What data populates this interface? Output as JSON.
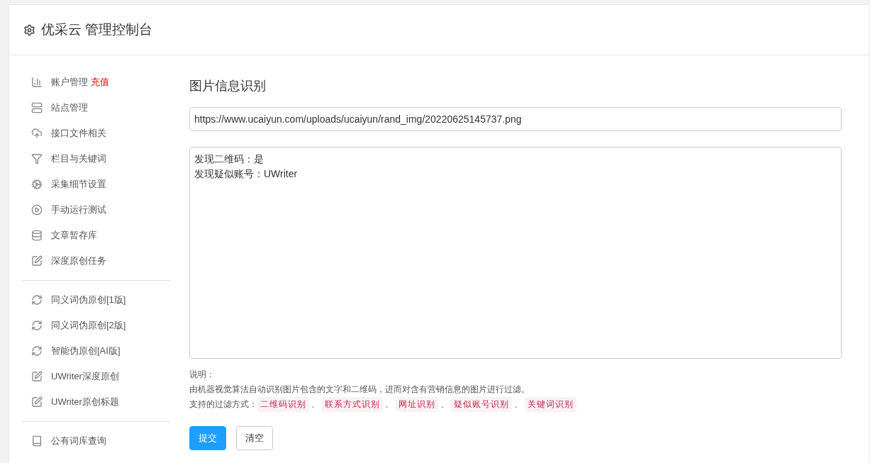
{
  "header": {
    "title": "优采云 管理控制台"
  },
  "sidebar": {
    "groups": [
      {
        "items": [
          {
            "kind": "chart",
            "label": "账户管理",
            "extra": "充值"
          },
          {
            "kind": "server",
            "label": "站点管理"
          },
          {
            "kind": "cloud",
            "label": "接口文件相关"
          },
          {
            "kind": "filter",
            "label": "栏目与关键词"
          },
          {
            "kind": "cogs",
            "label": "采集细节设置"
          },
          {
            "kind": "play",
            "label": "手动运行测试"
          },
          {
            "kind": "database",
            "label": "文章暂存库"
          },
          {
            "kind": "edit",
            "label": "深度原创任务"
          }
        ]
      },
      {
        "items": [
          {
            "kind": "refresh",
            "label": "同义词伪原创[1版]"
          },
          {
            "kind": "refresh",
            "label": "同义词伪原创[2版]"
          },
          {
            "kind": "refresh",
            "label": "智能伪原创[AI版]"
          },
          {
            "kind": "edit",
            "label": "UWriter深度原创"
          },
          {
            "kind": "edit",
            "label": "UWriter原创标题"
          }
        ]
      },
      {
        "items": [
          {
            "kind": "book",
            "label": "公有词库查询"
          }
        ]
      }
    ]
  },
  "main": {
    "title": "图片信息识别",
    "url_field": {
      "value": "https://www.ucaiyun.com/uploads/ucaiyun/rand_img/20220625145737.png"
    },
    "result_box": {
      "lines": [
        "发现二维码：是",
        "发现疑似账号：UWriter"
      ]
    },
    "note_label": "说明：",
    "description": "由机器视觉算法自动识别图片包含的文字和二维码，进而对含有营销信息的图片进行过滤。",
    "filters_label": "支持的过滤方式：",
    "filters": [
      "二维码识别",
      "联系方式识别",
      "网址识别",
      "疑似账号识别",
      "关键词识别"
    ],
    "separator": "、",
    "buttons": [
      {
        "kind": "primary",
        "label": "提交"
      },
      {
        "kind": "default",
        "label": "清空"
      }
    ]
  }
}
